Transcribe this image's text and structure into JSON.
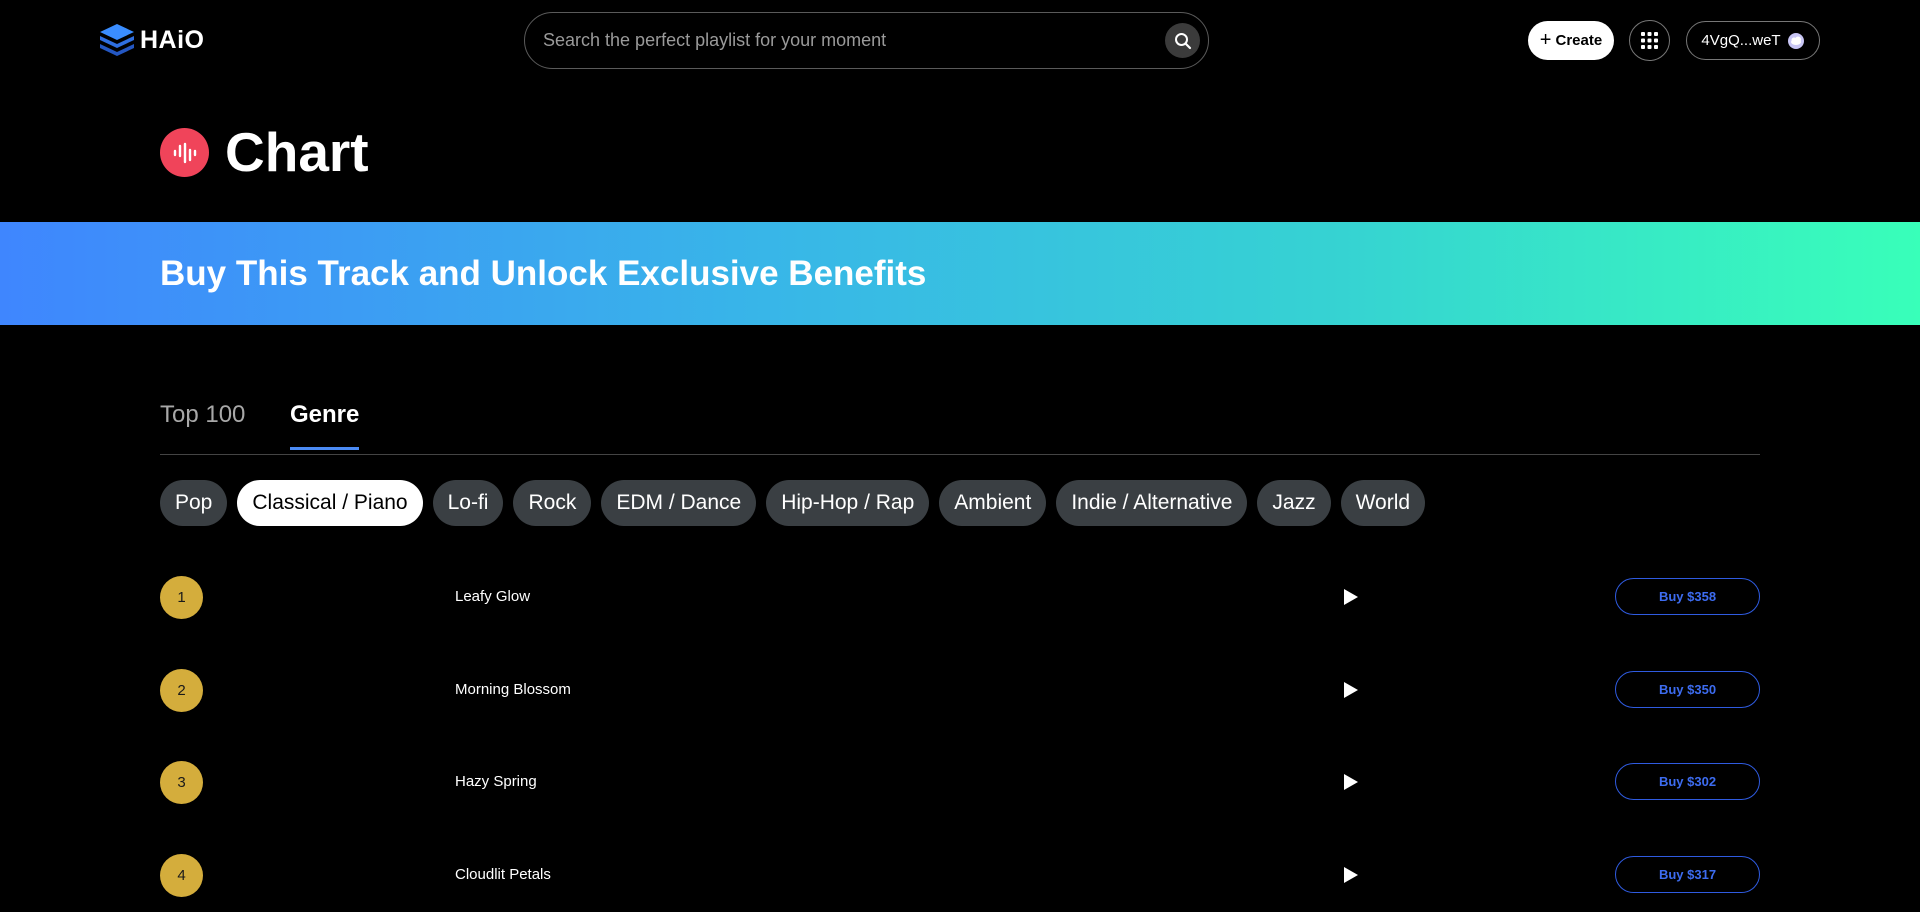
{
  "header": {
    "logo_text": "HAiO",
    "search_placeholder": "Search the perfect playlist for your moment",
    "create_label": "Create",
    "wallet_label": "4VgQ...weT"
  },
  "page": {
    "title": "Chart",
    "banner": "Buy This Track and Unlock Exclusive Benefits"
  },
  "tabs": [
    {
      "label": "Top 100",
      "active": false
    },
    {
      "label": "Genre",
      "active": true
    }
  ],
  "genres": [
    {
      "label": "Pop",
      "active": false
    },
    {
      "label": "Classical / Piano",
      "active": true
    },
    {
      "label": "Lo-fi",
      "active": false
    },
    {
      "label": "Rock",
      "active": false
    },
    {
      "label": "EDM / Dance",
      "active": false
    },
    {
      "label": "Hip-Hop / Rap",
      "active": false
    },
    {
      "label": "Ambient",
      "active": false
    },
    {
      "label": "Indie / Alternative",
      "active": false
    },
    {
      "label": "Jazz",
      "active": false
    },
    {
      "label": "World",
      "active": false
    }
  ],
  "tracks": [
    {
      "rank": "1",
      "name": "Leafy Glow",
      "buy_label": "Buy $358"
    },
    {
      "rank": "2",
      "name": "Morning Blossom",
      "buy_label": "Buy $350"
    },
    {
      "rank": "3",
      "name": "Hazy Spring",
      "buy_label": "Buy $302"
    },
    {
      "rank": "4",
      "name": "Cloudlit Petals",
      "buy_label": "Buy $317"
    }
  ],
  "icons": {
    "search": "search-icon",
    "apps": "grid-icon",
    "wallet": "wallet-avatar-icon",
    "title": "waveform-icon",
    "play": "play-icon"
  },
  "colors": {
    "accent": "#4b8bf5",
    "title_icon_bg": "#f0445a",
    "rank_badge": "#d4ad3c",
    "buy_text": "#3d6cf0",
    "banner_start": "#3f86fe",
    "banner_end": "#38ffb9"
  }
}
